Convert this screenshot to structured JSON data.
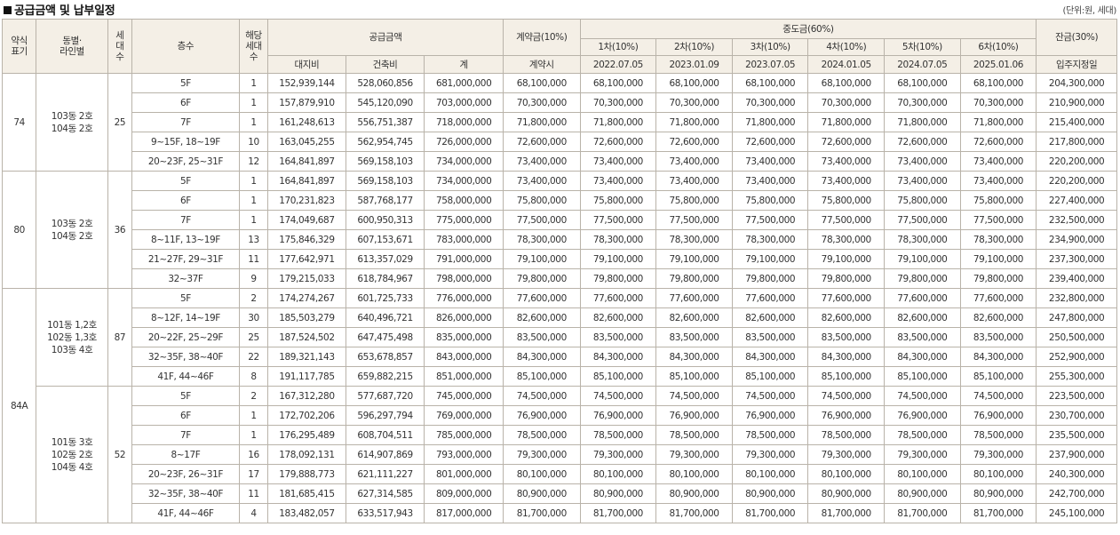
{
  "header": {
    "title": "공급금액 및 납부일정",
    "unit": "(단위:원, 세대)"
  },
  "columns": {
    "type": "약식\n표기",
    "dong_line": "동별·\n라인별",
    "households": "세\n대\n수",
    "floor": "층수",
    "applicable": "해당\n세대\n수",
    "supply": "공급금액",
    "land": "대지비",
    "building": "건축비",
    "total": "계",
    "deposit": "계약금(10%)",
    "deposit_when": "계약시",
    "middle": "중도금(60%)",
    "middle_terms": [
      "1차(10%)",
      "2차(10%)",
      "3차(10%)",
      "4차(10%)",
      "5차(10%)",
      "6차(10%)"
    ],
    "middle_dates": [
      "2022.07.05",
      "2023.01.09",
      "2023.07.05",
      "2024.01.05",
      "2024.07.05",
      "2025.01.06"
    ],
    "balance": "잔금(30%)",
    "balance_when": "입주지정일"
  },
  "types": [
    {
      "label": "74",
      "groups": [
        {
          "dong": "103동 2호\n104동 2호",
          "households": "25",
          "rows": [
            {
              "floor": "5F",
              "n": "1",
              "land": "152,939,144",
              "build": "528,060,856",
              "total": "681,000,000",
              "deposit": "68,100,000",
              "middle": "68,100,000",
              "balance": "204,300,000"
            },
            {
              "floor": "6F",
              "n": "1",
              "land": "157,879,910",
              "build": "545,120,090",
              "total": "703,000,000",
              "deposit": "70,300,000",
              "middle": "70,300,000",
              "balance": "210,900,000"
            },
            {
              "floor": "7F",
              "n": "1",
              "land": "161,248,613",
              "build": "556,751,387",
              "total": "718,000,000",
              "deposit": "71,800,000",
              "middle": "71,800,000",
              "balance": "215,400,000"
            },
            {
              "floor": "9~15F, 18~19F",
              "n": "10",
              "land": "163,045,255",
              "build": "562,954,745",
              "total": "726,000,000",
              "deposit": "72,600,000",
              "middle": "72,600,000",
              "balance": "217,800,000"
            },
            {
              "floor": "20~23F, 25~31F",
              "n": "12",
              "land": "164,841,897",
              "build": "569,158,103",
              "total": "734,000,000",
              "deposit": "73,400,000",
              "middle": "73,400,000",
              "balance": "220,200,000"
            }
          ]
        }
      ]
    },
    {
      "label": "80",
      "groups": [
        {
          "dong": "103동 2호\n104동 2호",
          "households": "36",
          "rows": [
            {
              "floor": "5F",
              "n": "1",
              "land": "164,841,897",
              "build": "569,158,103",
              "total": "734,000,000",
              "deposit": "73,400,000",
              "middle": "73,400,000",
              "balance": "220,200,000"
            },
            {
              "floor": "6F",
              "n": "1",
              "land": "170,231,823",
              "build": "587,768,177",
              "total": "758,000,000",
              "deposit": "75,800,000",
              "middle": "75,800,000",
              "balance": "227,400,000"
            },
            {
              "floor": "7F",
              "n": "1",
              "land": "174,049,687",
              "build": "600,950,313",
              "total": "775,000,000",
              "deposit": "77,500,000",
              "middle": "77,500,000",
              "balance": "232,500,000"
            },
            {
              "floor": "8~11F, 13~19F",
              "n": "13",
              "land": "175,846,329",
              "build": "607,153,671",
              "total": "783,000,000",
              "deposit": "78,300,000",
              "middle": "78,300,000",
              "balance": "234,900,000"
            },
            {
              "floor": "21~27F, 29~31F",
              "n": "11",
              "land": "177,642,971",
              "build": "613,357,029",
              "total": "791,000,000",
              "deposit": "79,100,000",
              "middle": "79,100,000",
              "balance": "237,300,000"
            },
            {
              "floor": "32~37F",
              "n": "9",
              "land": "179,215,033",
              "build": "618,784,967",
              "total": "798,000,000",
              "deposit": "79,800,000",
              "middle": "79,800,000",
              "balance": "239,400,000"
            }
          ]
        }
      ]
    },
    {
      "label": "84A",
      "groups": [
        {
          "dong": "101동 1,2호\n102동 1,3호\n103동 4호",
          "households": "87",
          "rows": [
            {
              "floor": "5F",
              "n": "2",
              "land": "174,274,267",
              "build": "601,725,733",
              "total": "776,000,000",
              "deposit": "77,600,000",
              "middle": "77,600,000",
              "balance": "232,800,000"
            },
            {
              "floor": "8~12F, 14~19F",
              "n": "30",
              "land": "185,503,279",
              "build": "640,496,721",
              "total": "826,000,000",
              "deposit": "82,600,000",
              "middle": "82,600,000",
              "balance": "247,800,000"
            },
            {
              "floor": "20~22F, 25~29F",
              "n": "25",
              "land": "187,524,502",
              "build": "647,475,498",
              "total": "835,000,000",
              "deposit": "83,500,000",
              "middle": "83,500,000",
              "balance": "250,500,000"
            },
            {
              "floor": "32~35F, 38~40F",
              "n": "22",
              "land": "189,321,143",
              "build": "653,678,857",
              "total": "843,000,000",
              "deposit": "84,300,000",
              "middle": "84,300,000",
              "balance": "252,900,000"
            },
            {
              "floor": "41F, 44~46F",
              "n": "8",
              "land": "191,117,785",
              "build": "659,882,215",
              "total": "851,000,000",
              "deposit": "85,100,000",
              "middle": "85,100,000",
              "balance": "255,300,000"
            }
          ]
        },
        {
          "dong": "101동 3호\n102동 2호\n104동 4호",
          "households": "52",
          "rows": [
            {
              "floor": "5F",
              "n": "2",
              "land": "167,312,280",
              "build": "577,687,720",
              "total": "745,000,000",
              "deposit": "74,500,000",
              "middle": "74,500,000",
              "balance": "223,500,000"
            },
            {
              "floor": "6F",
              "n": "1",
              "land": "172,702,206",
              "build": "596,297,794",
              "total": "769,000,000",
              "deposit": "76,900,000",
              "middle": "76,900,000",
              "balance": "230,700,000"
            },
            {
              "floor": "7F",
              "n": "1",
              "land": "176,295,489",
              "build": "608,704,511",
              "total": "785,000,000",
              "deposit": "78,500,000",
              "middle": "78,500,000",
              "balance": "235,500,000"
            },
            {
              "floor": "8~17F",
              "n": "16",
              "land": "178,092,131",
              "build": "614,907,869",
              "total": "793,000,000",
              "deposit": "79,300,000",
              "middle": "79,300,000",
              "balance": "237,900,000"
            },
            {
              "floor": "20~23F, 26~31F",
              "n": "17",
              "land": "179,888,773",
              "build": "621,111,227",
              "total": "801,000,000",
              "deposit": "80,100,000",
              "middle": "80,100,000",
              "balance": "240,300,000"
            },
            {
              "floor": "32~35F, 38~40F",
              "n": "11",
              "land": "181,685,415",
              "build": "627,314,585",
              "total": "809,000,000",
              "deposit": "80,900,000",
              "middle": "80,900,000",
              "balance": "242,700,000"
            },
            {
              "floor": "41F, 44~46F",
              "n": "4",
              "land": "183,482,057",
              "build": "633,517,943",
              "total": "817,000,000",
              "deposit": "81,700,000",
              "middle": "81,700,000",
              "balance": "245,100,000"
            }
          ]
        }
      ]
    }
  ]
}
